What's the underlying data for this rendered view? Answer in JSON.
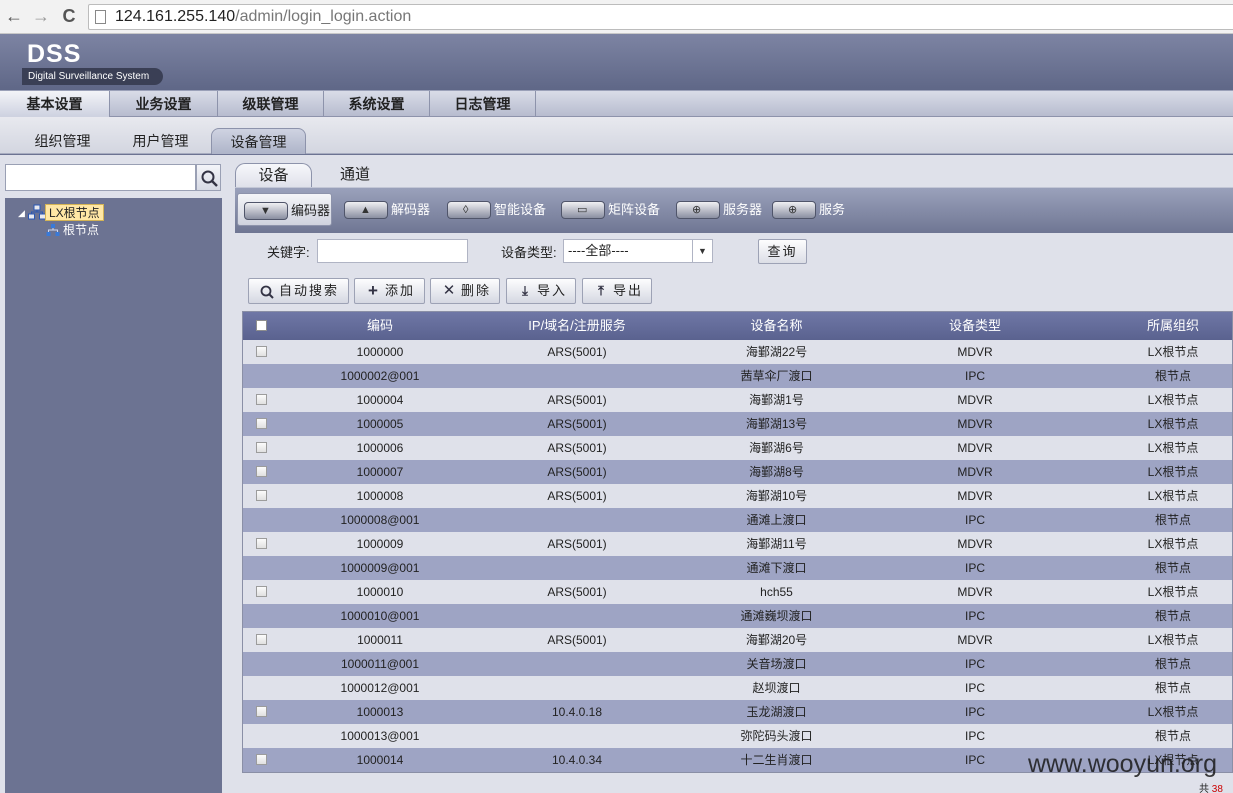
{
  "browser": {
    "back_glyph": "←",
    "forward_glyph": "→",
    "reload_glyph": "C",
    "url_host": "124.161.255.140",
    "url_path": "/admin/login_login.action"
  },
  "app": {
    "logo": "DSS",
    "subtitle": "Digital Surveillance System"
  },
  "main_menu": [
    "基本设置",
    "业务设置",
    "级联管理",
    "系统设置",
    "日志管理"
  ],
  "sub_tabs": [
    "组织管理",
    "用户管理",
    "设备管理"
  ],
  "tree": {
    "root": "LX根节点",
    "child": "根节点"
  },
  "device_tabs": [
    "设备",
    "通道"
  ],
  "device_types": [
    "编码器",
    "解码器",
    "智能设备",
    "矩阵设备",
    "服务器",
    "服务"
  ],
  "filter": {
    "keyword_label": "关键字:",
    "type_label": "设备类型:",
    "type_value": "----全部----",
    "query_label": "查询"
  },
  "actions": {
    "auto_search": "自动搜索",
    "add": "添加",
    "delete": "删除",
    "import": "导入",
    "export": "导出"
  },
  "table": {
    "headers": [
      "编码",
      "IP/域名/注册服务",
      "设备名称",
      "设备类型",
      "所属组织"
    ],
    "rows": [
      {
        "code": "1000000",
        "ip": "ARS(5001)",
        "name": "海鄞湖22号",
        "type": "MDVR",
        "org": "LX根节点",
        "cb": true
      },
      {
        "code": "1000002@001",
        "ip": "",
        "name": "茜草伞厂渡口",
        "type": "IPC",
        "org": "根节点",
        "cb": false
      },
      {
        "code": "1000004",
        "ip": "ARS(5001)",
        "name": "海鄞湖1号",
        "type": "MDVR",
        "org": "LX根节点",
        "cb": true
      },
      {
        "code": "1000005",
        "ip": "ARS(5001)",
        "name": "海鄞湖13号",
        "type": "MDVR",
        "org": "LX根节点",
        "cb": true
      },
      {
        "code": "1000006",
        "ip": "ARS(5001)",
        "name": "海鄞湖6号",
        "type": "MDVR",
        "org": "LX根节点",
        "cb": true
      },
      {
        "code": "1000007",
        "ip": "ARS(5001)",
        "name": "海鄞湖8号",
        "type": "MDVR",
        "org": "LX根节点",
        "cb": true
      },
      {
        "code": "1000008",
        "ip": "ARS(5001)",
        "name": "海鄞湖10号",
        "type": "MDVR",
        "org": "LX根节点",
        "cb": true
      },
      {
        "code": "1000008@001",
        "ip": "",
        "name": "通滩上渡口",
        "type": "IPC",
        "org": "根节点",
        "cb": false
      },
      {
        "code": "1000009",
        "ip": "ARS(5001)",
        "name": "海鄞湖11号",
        "type": "MDVR",
        "org": "LX根节点",
        "cb": true
      },
      {
        "code": "1000009@001",
        "ip": "",
        "name": "通滩下渡口",
        "type": "IPC",
        "org": "根节点",
        "cb": false
      },
      {
        "code": "1000010",
        "ip": "ARS(5001)",
        "name": "hch55",
        "type": "MDVR",
        "org": "LX根节点",
        "cb": true
      },
      {
        "code": "1000010@001",
        "ip": "",
        "name": "通滩巍坝渡口",
        "type": "IPC",
        "org": "根节点",
        "cb": false
      },
      {
        "code": "1000011",
        "ip": "ARS(5001)",
        "name": "海鄞湖20号",
        "type": "MDVR",
        "org": "LX根节点",
        "cb": true
      },
      {
        "code": "1000011@001",
        "ip": "",
        "name": "关音场渡口",
        "type": "IPC",
        "org": "根节点",
        "cb": false
      },
      {
        "code": "1000012@001",
        "ip": "",
        "name": "赵坝渡口",
        "type": "IPC",
        "org": "根节点",
        "cb": false
      },
      {
        "code": "1000013",
        "ip": "10.4.0.18",
        "name": "玉龙湖渡口",
        "type": "IPC",
        "org": "LX根节点",
        "cb": true
      },
      {
        "code": "1000013@001",
        "ip": "",
        "name": "弥陀码头渡口",
        "type": "IPC",
        "org": "根节点",
        "cb": false
      },
      {
        "code": "1000014",
        "ip": "10.4.0.34",
        "name": "十二生肖渡口",
        "type": "IPC",
        "org": "LX根节点",
        "cb": true
      }
    ]
  },
  "watermark": "www.wooyun.org",
  "pager": {
    "prefix": "共",
    "count": "38"
  },
  "colors": {
    "header": "#6f77a6",
    "row_alt": "#9ea4c4",
    "panel": "#dfe1ea"
  }
}
